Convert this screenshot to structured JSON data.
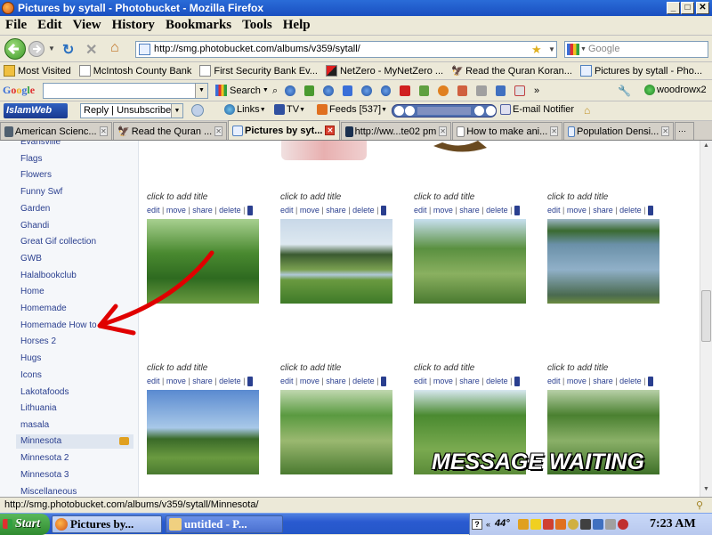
{
  "window": {
    "title": "Pictures by sytall - Photobucket - Mozilla Firefox"
  },
  "menu": [
    "File",
    "Edit",
    "View",
    "History",
    "Bookmarks",
    "Tools",
    "Help"
  ],
  "nav": {
    "url": "http://smg.photobucket.com/albums/v359/sytall/",
    "search_placeholder": "Google"
  },
  "bookmarks": [
    "Most Visited",
    "McIntosh County Bank",
    "First Security Bank Ev...",
    "NetZero - MyNetZero ...",
    "Read the Quran Koran...",
    "Pictures by sytall - Pho..."
  ],
  "googlebar": {
    "logo": "Google",
    "search_label": "Search",
    "user": "woodrowx2"
  },
  "islambar": {
    "logo": "IslamWeb 2.0",
    "reply_label": "Reply | Unsubscribe",
    "links": "Links",
    "tv": "TV",
    "feeds": "Feeds [537]",
    "email": "E-mail Notifier"
  },
  "tabs": [
    {
      "label": "American Scienc...",
      "active": false
    },
    {
      "label": "Read the Quran ...",
      "active": false
    },
    {
      "label": "Pictures by syt...",
      "active": true
    },
    {
      "label": "http://ww...te02 pm",
      "active": false
    },
    {
      "label": "How to make ani...",
      "active": false
    },
    {
      "label": "Population Densi...",
      "active": false
    }
  ],
  "sidebar": {
    "items": [
      "Evansville",
      "Flags",
      "Flowers",
      "Funny Swf",
      "Garden",
      "Ghandi",
      "Great Gif collection",
      "GWB",
      "Halalbookclub",
      "Home",
      "Homemade",
      "Homemade How to",
      "Horses 2",
      "Hugs",
      "Icons",
      "Lakotafoods",
      "Lithuania",
      "masala",
      "Minnesota",
      "Minnesota 2",
      "Minnesota 3",
      "Miscellaneous"
    ],
    "active": "Minnesota"
  },
  "photos": {
    "caption": "click to add title",
    "action_edit": "edit",
    "action_move": "move",
    "action_share": "share",
    "action_delete": "delete",
    "sep": "|"
  },
  "overlay": {
    "message": "MESSAGE WAITING"
  },
  "status": {
    "text": "http://smg.photobucket.com/albums/v359/sytall/Minnesota/"
  },
  "taskbar": {
    "start": "Start",
    "window1": "Pictures by...",
    "window2": "untitled - P...",
    "temp": "44°",
    "clock": "7:23 AM"
  },
  "colors": {
    "link": "#2a3f8f",
    "xp_blue": "#2457c8",
    "arrow": "#e00000"
  }
}
